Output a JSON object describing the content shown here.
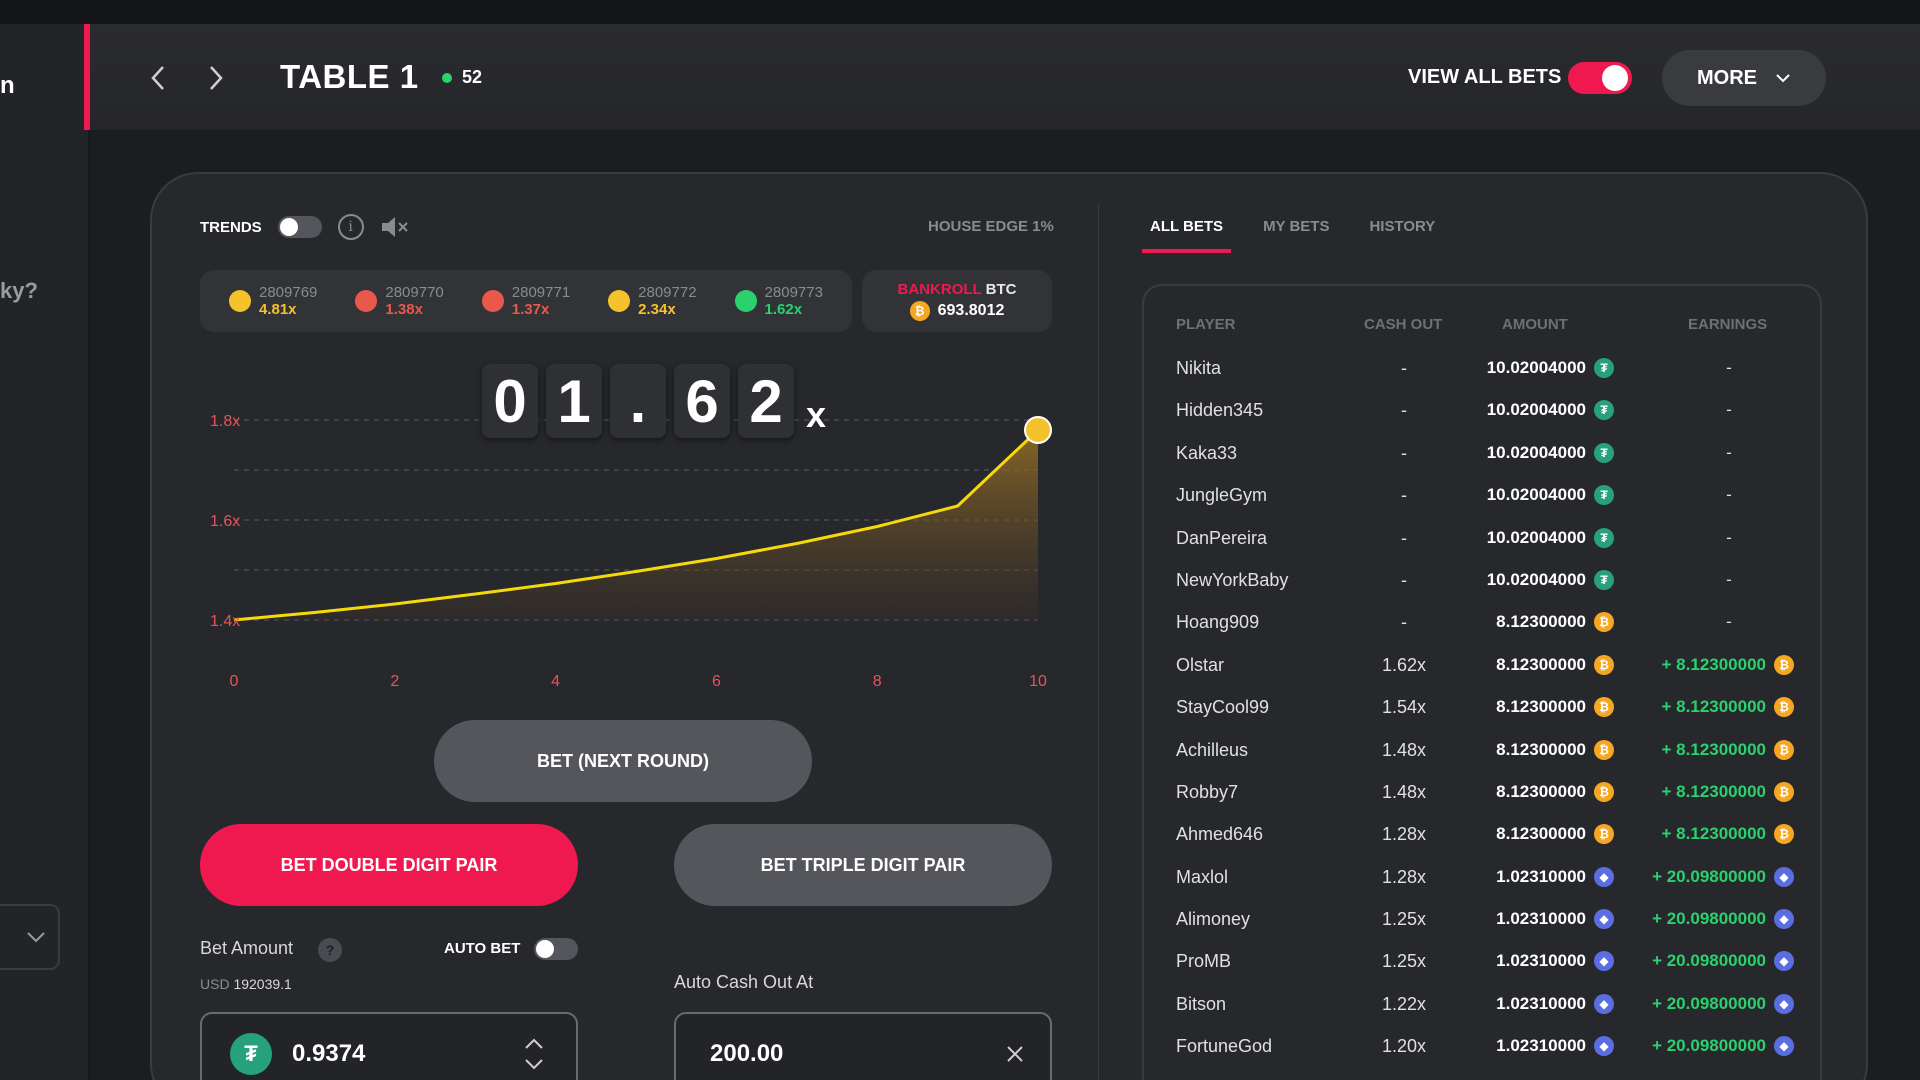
{
  "left_column": {
    "fragment_top": "n",
    "fragment_mid": "ky?"
  },
  "header": {
    "title": "TABLE 1",
    "online_count": "52",
    "view_all_label": "VIEW ALL BETS",
    "view_all_on": true,
    "more_label": "MORE"
  },
  "game": {
    "trends_label": "TRENDS",
    "house_edge": "HOUSE EDGE 1%",
    "history": [
      {
        "id": "2809769",
        "mult": "4.81x",
        "color": "#f5c22b"
      },
      {
        "id": "2809770",
        "mult": "1.38x",
        "color": "#e8584b"
      },
      {
        "id": "2809771",
        "mult": "1.37x",
        "color": "#e8584b"
      },
      {
        "id": "2809772",
        "mult": "2.34x",
        "color": "#f5c22b"
      },
      {
        "id": "2809773",
        "mult": "1.62x",
        "color": "#2ad16e"
      }
    ],
    "bankroll": {
      "label": "BANKROLL",
      "currency": "BTC",
      "value": "693.8012"
    },
    "multiplier_digits": [
      "0",
      "1",
      ".",
      "6",
      "2"
    ],
    "multiplier_suffix": "x",
    "bet_next_label": "BET (NEXT ROUND)",
    "bet_double_label": "BET DOUBLE DIGIT PAIR",
    "bet_triple_label": "BET TRIPLE DIGIT PAIR",
    "bet_amount_label": "Bet Amount",
    "auto_bet_label": "AUTO BET",
    "usd_label": "USD",
    "usd_value": "192039.1",
    "bet_amount_value": "0.9374",
    "auto_cashout_label": "Auto Cash Out At",
    "auto_cashout_value": "200.00"
  },
  "chart_data": {
    "type": "area",
    "x_ticks": [
      "0",
      "2",
      "4",
      "6",
      "8",
      "10"
    ],
    "y_ticks": [
      "1.4x",
      "1.6x",
      "1.8x"
    ],
    "xlim": [
      0,
      10
    ],
    "ylim": [
      1.4,
      1.8
    ],
    "x": [
      0,
      1,
      2,
      3,
      4,
      5,
      6,
      7,
      8,
      9,
      10
    ],
    "y": [
      1.4,
      1.415,
      1.432,
      1.452,
      1.473,
      1.497,
      1.523,
      1.553,
      1.587,
      1.628,
      1.78
    ],
    "current_point": {
      "x": 10,
      "y": 1.78
    },
    "line_color": "#f5d90a"
  },
  "bets_panel": {
    "tabs": [
      "ALL BETS",
      "MY BETS",
      "HISTORY"
    ],
    "columns": [
      "PLAYER",
      "CASH OUT",
      "AMOUNT",
      "EARNINGS"
    ],
    "rows": [
      {
        "player": "Nikita",
        "cashout": "-",
        "amount": "10.02004000",
        "coin": "usdt",
        "earnings": "-"
      },
      {
        "player": "Hidden345",
        "cashout": "-",
        "amount": "10.02004000",
        "coin": "usdt",
        "earnings": "-"
      },
      {
        "player": "Kaka33",
        "cashout": "-",
        "amount": "10.02004000",
        "coin": "usdt",
        "earnings": "-"
      },
      {
        "player": "JungleGym",
        "cashout": "-",
        "amount": "10.02004000",
        "coin": "usdt",
        "earnings": "-"
      },
      {
        "player": "DanPereira",
        "cashout": "-",
        "amount": "10.02004000",
        "coin": "usdt",
        "earnings": "-"
      },
      {
        "player": "NewYorkBaby",
        "cashout": "-",
        "amount": "10.02004000",
        "coin": "usdt",
        "earnings": "-"
      },
      {
        "player": "Hoang909",
        "cashout": "-",
        "amount": "8.12300000",
        "coin": "btc",
        "earnings": "-"
      },
      {
        "player": "Olstar",
        "cashout": "1.62x",
        "amount": "8.12300000",
        "coin": "btc",
        "earnings": "+ 8.12300000"
      },
      {
        "player": "StayCool99",
        "cashout": "1.54x",
        "amount": "8.12300000",
        "coin": "btc",
        "earnings": "+ 8.12300000"
      },
      {
        "player": "Achilleus",
        "cashout": "1.48x",
        "amount": "8.12300000",
        "coin": "btc",
        "earnings": "+ 8.12300000"
      },
      {
        "player": "Robby7",
        "cashout": "1.48x",
        "amount": "8.12300000",
        "coin": "btc",
        "earnings": "+ 8.12300000"
      },
      {
        "player": "Ahmed646",
        "cashout": "1.28x",
        "amount": "8.12300000",
        "coin": "btc",
        "earnings": "+ 8.12300000"
      },
      {
        "player": "Maxlol",
        "cashout": "1.28x",
        "amount": "1.02310000",
        "coin": "eth",
        "earnings": "+ 20.09800000"
      },
      {
        "player": "Alimoney",
        "cashout": "1.25x",
        "amount": "1.02310000",
        "coin": "eth",
        "earnings": "+ 20.09800000"
      },
      {
        "player": "ProMB",
        "cashout": "1.25x",
        "amount": "1.02310000",
        "coin": "eth",
        "earnings": "+ 20.09800000"
      },
      {
        "player": "Bitson",
        "cashout": "1.22x",
        "amount": "1.02310000",
        "coin": "eth",
        "earnings": "+ 20.09800000"
      },
      {
        "player": "FortuneGod",
        "cashout": "1.20x",
        "amount": "1.02310000",
        "coin": "eth",
        "earnings": "+ 20.09800000"
      }
    ]
  }
}
